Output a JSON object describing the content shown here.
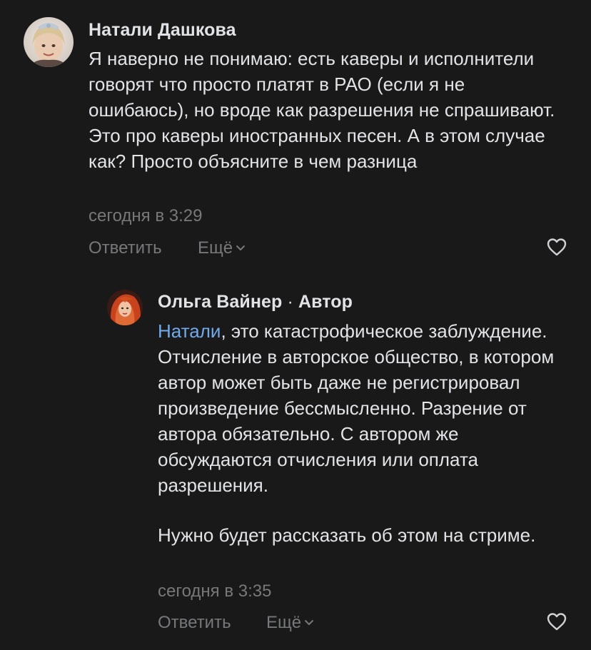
{
  "comments": [
    {
      "author": "Натали Дашкова",
      "text": "Я наверно не понимаю: есть каверы и исполнители говорят что просто платят в РАО (если я не ошибаюсь), но вроде как разрешения не спрашивают. Это про каверы иностранных песен. А в этом случае как? Просто объясните в чем разница",
      "date": "сегодня в 3:29",
      "reply_label": "Ответить",
      "more_label": "Ещё"
    },
    {
      "author": "Ольга Вайнер",
      "separator": "·",
      "role": "Автор",
      "mention": "Натали",
      "text_after_mention": ", это катастрофическое заблуждение. Отчисление в авторское общество, в котором автор может быть даже не регистрировал произведение бессмысленно. Разрение от автора обязательно. С автором же обсуждаются отчисления или оплата разрешения.",
      "text_paragraph2": "Нужно будет рассказать об этом на стриме.",
      "date": "сегодня в 3:35",
      "reply_label": "Ответить",
      "more_label": "Ещё"
    }
  ],
  "icons": {
    "like": "heart-outline-icon",
    "chevron": "chevron-down-icon"
  },
  "colors": {
    "background": "#19191a",
    "text": "#e1e3e6",
    "secondary": "#76787a",
    "link": "#71aaeb"
  }
}
